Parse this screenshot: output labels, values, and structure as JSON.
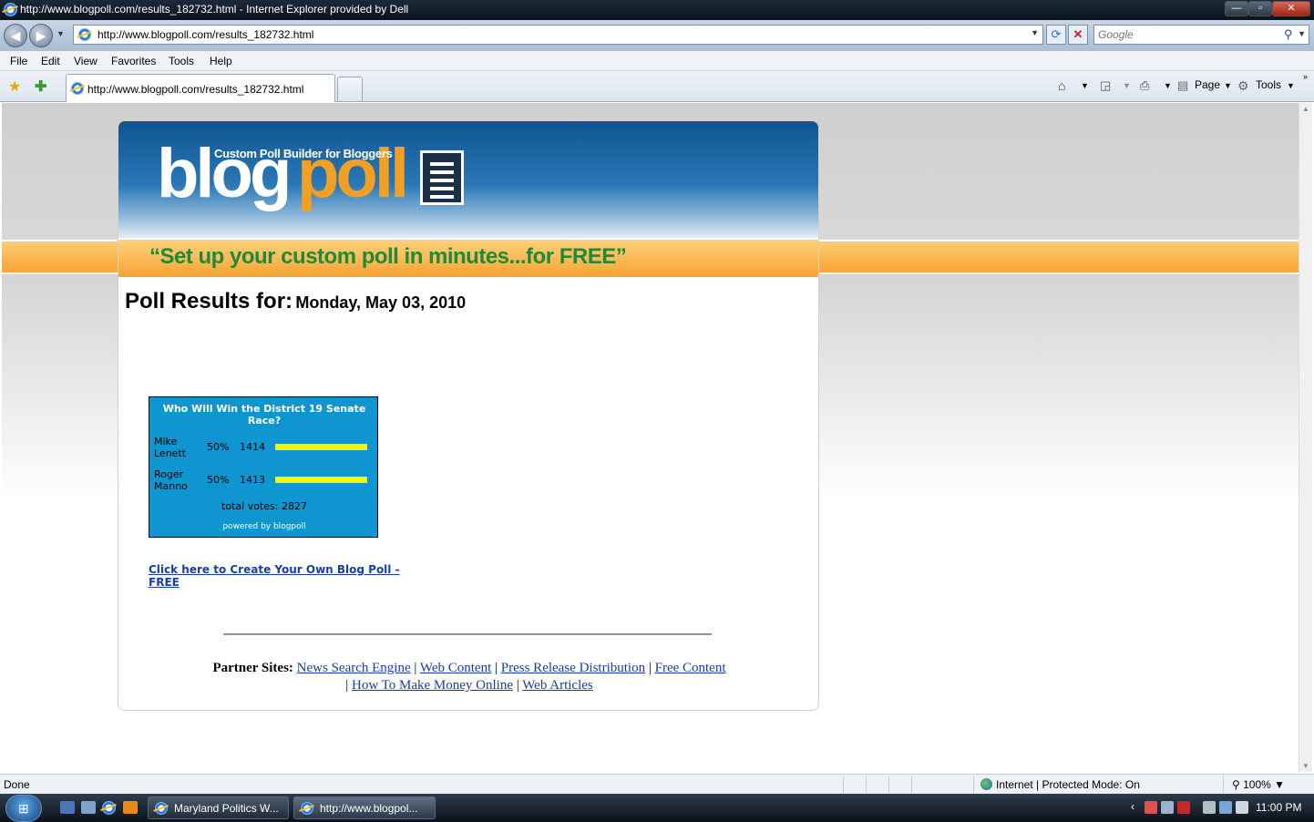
{
  "window": {
    "title": "http://www.blogpoll.com/results_182732.html - Internet Explorer provided by Dell",
    "controls": {
      "minimize": "—",
      "maximize": "▫",
      "close": "✕"
    }
  },
  "toolbar": {
    "url": "http://www.blogpoll.com/results_182732.html",
    "search_placeholder": "Google"
  },
  "menu": [
    "File",
    "Edit",
    "View",
    "Favorites",
    "Tools",
    "Help"
  ],
  "tab": {
    "label": "http://www.blogpoll.com/results_182732.html"
  },
  "commands": {
    "page": "Page",
    "tools": "Tools"
  },
  "site": {
    "logo_subtitle": "Custom Poll Builder for Bloggers",
    "logo_blog": "blog",
    "logo_poll": "poll",
    "slogan": "“Set up your custom poll in minutes...for FREE”",
    "results_label": "Poll Results for:",
    "results_date": "Monday, May 03, 2010"
  },
  "poll": {
    "question": "Who Will Win the District 19 Senate Race?",
    "options": [
      {
        "name_line1": "Mike",
        "name_line2": "Lenett",
        "percent": "50%",
        "votes": "1414",
        "fraction": 1.0
      },
      {
        "name_line1": "Roger",
        "name_line2": "Manno",
        "percent": "50%",
        "votes": "1413",
        "fraction": 1.0
      }
    ],
    "total": "total votes: 2827",
    "powered": "powered by blogpoll",
    "bar_color": "#f6f600",
    "widget_color": "#0f95cf"
  },
  "create_link": "Click here to Create Your Own Blog Poll - FREE",
  "partners": {
    "label": "Partner Sites:",
    "links": [
      "News Search Engine",
      "Web Content",
      "Press Release Distribution",
      "Free Content",
      "How To Make Money Online",
      "Web Articles"
    ]
  },
  "status": {
    "text": "Done",
    "zone": "Internet | Protected Mode: On",
    "zoom": "100%"
  },
  "taskbar": {
    "tasks": [
      "Maryland Politics W...",
      "http://www.blogpol..."
    ],
    "clock": "11:00 PM"
  }
}
